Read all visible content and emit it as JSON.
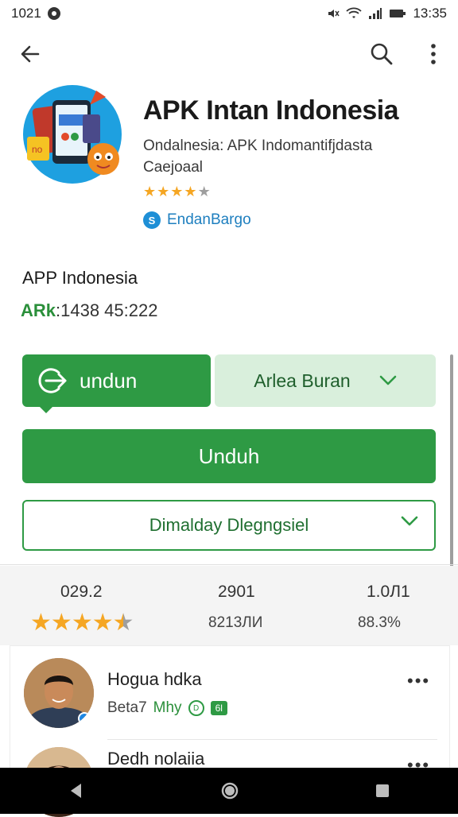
{
  "status_bar": {
    "left_text": "1021",
    "time": "13:35"
  },
  "app": {
    "title": "APK Intan Indonesia",
    "subtitle_line1": "Ondalnesia: APK Indomantifjdasta",
    "subtitle_line2": "Caejoaal",
    "rating_stars": 4,
    "developer": "EndanBargo",
    "developer_icon_glyph": "S"
  },
  "section": {
    "title": "APP Indonesia",
    "code_prefix": "ARk",
    "code_value": ":1438 45:222"
  },
  "buttons": {
    "undun_label": "undun",
    "area_label": "Arlea Buran",
    "main_label": "Unduh",
    "outline_label": "Dimalday Dlegngsiel"
  },
  "stats": {
    "rating_value": "029.2",
    "count_value": "2901",
    "version_value": "1.0Л1",
    "count_sub": "8213ЛИ",
    "percent_sub": "88.3%",
    "overall_stars": 4.5
  },
  "reviews": [
    {
      "name": "Hogua hdka",
      "meta": "Beta7",
      "meta_green": "Mhy",
      "badge": "6l",
      "ring": "D"
    },
    {
      "name": "Dedh nolaiia"
    }
  ],
  "colors": {
    "accent": "#2e9a44",
    "accent_light": "#d9efdc",
    "star": "#f5a623"
  }
}
